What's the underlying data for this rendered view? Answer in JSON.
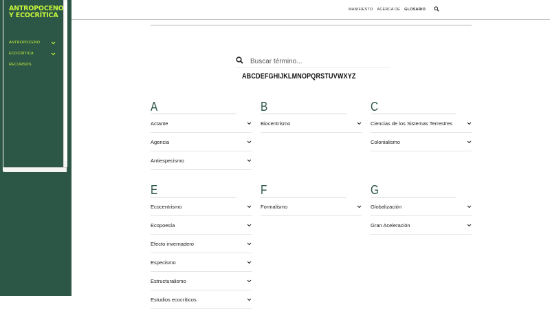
{
  "sidebar": {
    "brand": "ANTROPOCENO Y ECOCRÍTICA",
    "items": [
      {
        "label": "Antropoceno",
        "expandable": true
      },
      {
        "label": "Ecocrítica",
        "expandable": true
      },
      {
        "label": "Recursos",
        "expandable": false
      }
    ]
  },
  "topnav": {
    "links": [
      "MANIFIESTO",
      "ACERCA DE",
      "GLOSARIO"
    ],
    "active": "GLOSARIO",
    "search_icon": "search-icon"
  },
  "search": {
    "placeholder": "Buscar término..."
  },
  "alphabet": [
    "A",
    "B",
    "C",
    "D",
    "E",
    "F",
    "G",
    "H",
    "I",
    "J",
    "K",
    "L",
    "M",
    "N",
    "O",
    "P",
    "Q",
    "R",
    "S",
    "T",
    "U",
    "V",
    "W",
    "X",
    "Y",
    "Z"
  ],
  "sections": [
    {
      "letter": "A",
      "terms": [
        "Actante",
        "Agencia",
        "Antiespecismo"
      ]
    },
    {
      "letter": "B",
      "terms": [
        "Biocentrismo"
      ]
    },
    {
      "letter": "C",
      "terms": [
        "Ciencias de los Sistemas Terrestres",
        "Colonialismo"
      ]
    },
    {
      "letter": "E",
      "terms": [
        "Ecocentrismo",
        "Ecopoesía",
        "Efecto invernadero",
        "Especismo",
        "Estructuralismo",
        "Estudios ecocríticos"
      ]
    },
    {
      "letter": "F",
      "terms": [
        "Formalismo"
      ]
    },
    {
      "letter": "G",
      "terms": [
        "Globalización",
        "Gran Aceleración"
      ]
    }
  ],
  "colors": {
    "sidebar_bg": "#2c5646",
    "accent": "#c5f53a",
    "heading": "#2c5646"
  }
}
